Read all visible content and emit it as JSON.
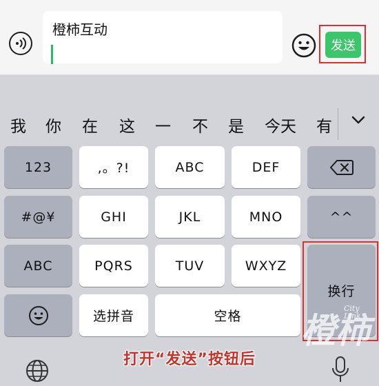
{
  "input_bar": {
    "text_value": "橙柿互动",
    "send_label": "发送"
  },
  "candidates": [
    "我",
    "你",
    "在",
    "这",
    "一",
    "不",
    "是",
    "今天",
    "有"
  ],
  "keys": {
    "row1": [
      "123",
      ",。?!",
      "ABC",
      "DEF"
    ],
    "row2": [
      "#@¥",
      "GHI",
      "JKL",
      "MNO",
      "^^"
    ],
    "row3": [
      "ABC",
      "PQRS",
      "TUV",
      "WXYZ"
    ],
    "row4": [
      "选拼音",
      "空格"
    ],
    "enter": "换行"
  },
  "caption": "打开“发送”按钮后",
  "watermark": {
    "text": "橙柿",
    "city": "City",
    "link": "Link"
  },
  "icons": {
    "voice": "voice-icon",
    "emoji": "emoji-icon",
    "delete": "backspace-icon",
    "collapse": "chevron-down-icon",
    "globe": "globe-icon",
    "mic": "microphone-icon"
  },
  "colors": {
    "send_button": "#3cc56a",
    "cursor": "#1fc15f",
    "highlight": "#d93030",
    "caption": "#c7332a"
  }
}
